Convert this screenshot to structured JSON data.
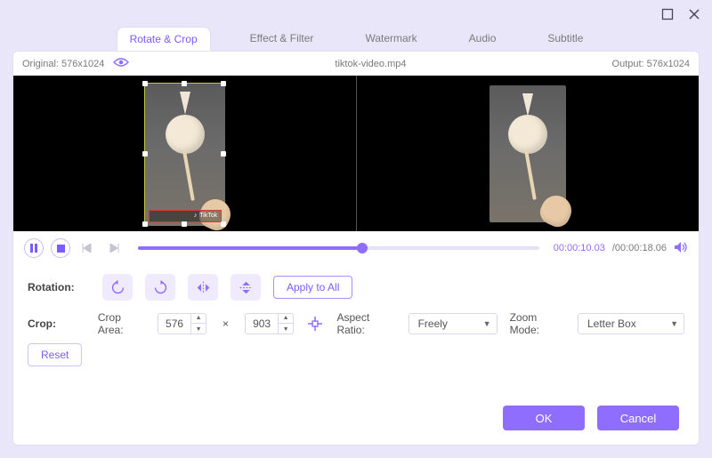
{
  "window": {
    "maximize_icon": "maximize",
    "close_icon": "close"
  },
  "tabs": [
    {
      "label": "Rotate & Crop",
      "active": true
    },
    {
      "label": "Effect & Filter",
      "active": false
    },
    {
      "label": "Watermark",
      "active": false
    },
    {
      "label": "Audio",
      "active": false
    },
    {
      "label": "Subtitle",
      "active": false
    }
  ],
  "meta": {
    "original_label": "Original: 576x1024",
    "filename": "tiktok-video.mp4",
    "output_label": "Output: 576x1024"
  },
  "crop_overlay": {
    "watermark_text": "TikTok"
  },
  "playback": {
    "progress_pct": 56,
    "current": "00:00:10.03",
    "total": "/00:00:18.06"
  },
  "rotation": {
    "label": "Rotation:",
    "apply_all_label": "Apply to All"
  },
  "crop": {
    "label": "Crop:",
    "area_label": "Crop Area:",
    "width": "576",
    "height": "903",
    "x_symbol": "×",
    "aspect_label": "Aspect Ratio:",
    "aspect_value": "Freely",
    "zoom_label": "Zoom Mode:",
    "zoom_value": "Letter Box",
    "reset_label": "Reset"
  },
  "footer": {
    "ok": "OK",
    "cancel": "Cancel"
  }
}
